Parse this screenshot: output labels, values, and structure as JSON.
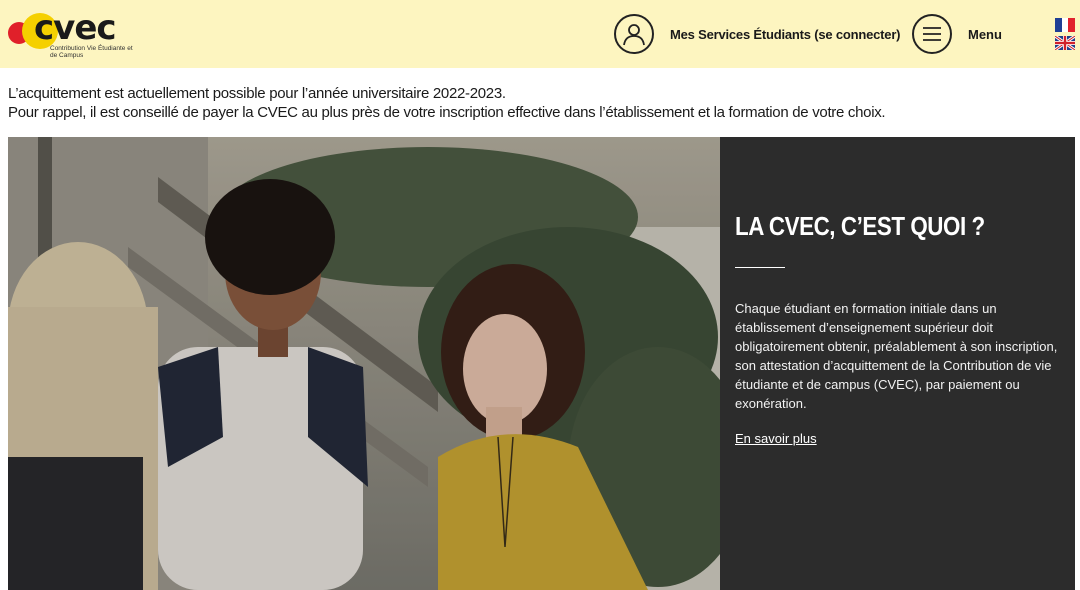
{
  "header": {
    "logo": {
      "word": "cvec",
      "subtitle": "Contribution Vie Étudiante et de Campus"
    },
    "services_label": "Mes Services Étudiants (se connecter)",
    "menu_label": "Menu",
    "languages": [
      "fr",
      "en"
    ]
  },
  "notice": {
    "line1": "L’acquittement est actuellement possible pour l’année universitaire  2022-2023.",
    "line2": "Pour rappel, il est conseillé de payer la CVEC au plus près de votre inscription effective dans l’établissement et la formation de votre choix."
  },
  "hero": {
    "title": "LA CVEC, C’EST QUOI ?",
    "text": "Chaque étudiant en formation initiale dans un établissement d’enseignement supérieur doit obligatoirement obtenir, préalablement à son inscription, son attestation d’acquittement de la Contribution de vie étudiante et de campus (CVEC), par paiement ou exonération.",
    "link_label": "En savoir plus"
  },
  "colors": {
    "header_bg": "#fdf5c0",
    "logo_red": "#e0202a",
    "logo_yellow": "#f5d000",
    "panel_bg": "#2c2c2c"
  }
}
